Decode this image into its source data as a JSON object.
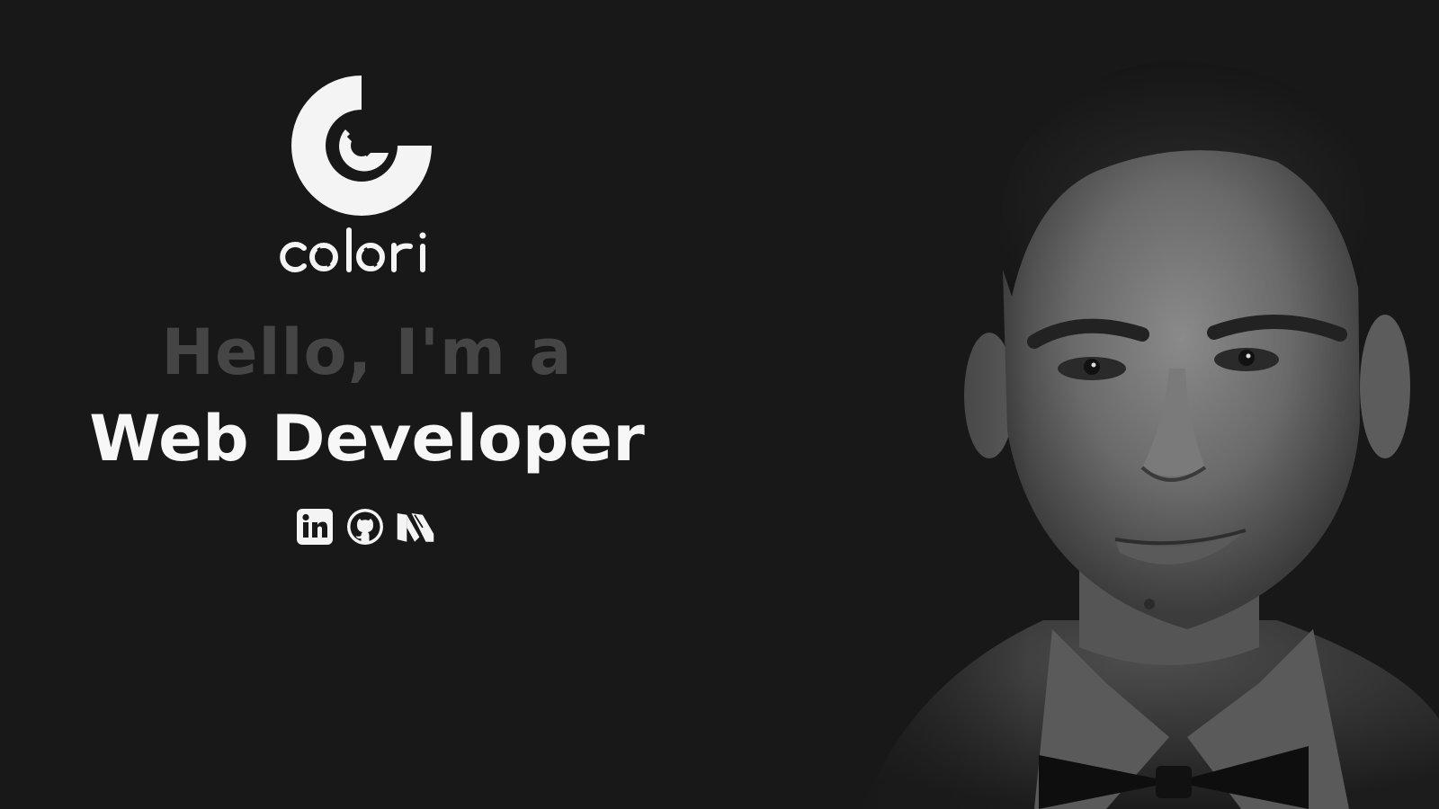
{
  "brand": {
    "name": "colori"
  },
  "hero": {
    "greeting": "Hello, I'm a",
    "role": "Web Developer"
  },
  "socials": [
    {
      "name": "linkedin",
      "icon": "linkedin-icon"
    },
    {
      "name": "github",
      "icon": "github-icon"
    },
    {
      "name": "medium",
      "icon": "medium-icon"
    }
  ],
  "colors": {
    "background": "#181818",
    "headline_primary": "#f7f7f7",
    "headline_muted": "#454545"
  }
}
